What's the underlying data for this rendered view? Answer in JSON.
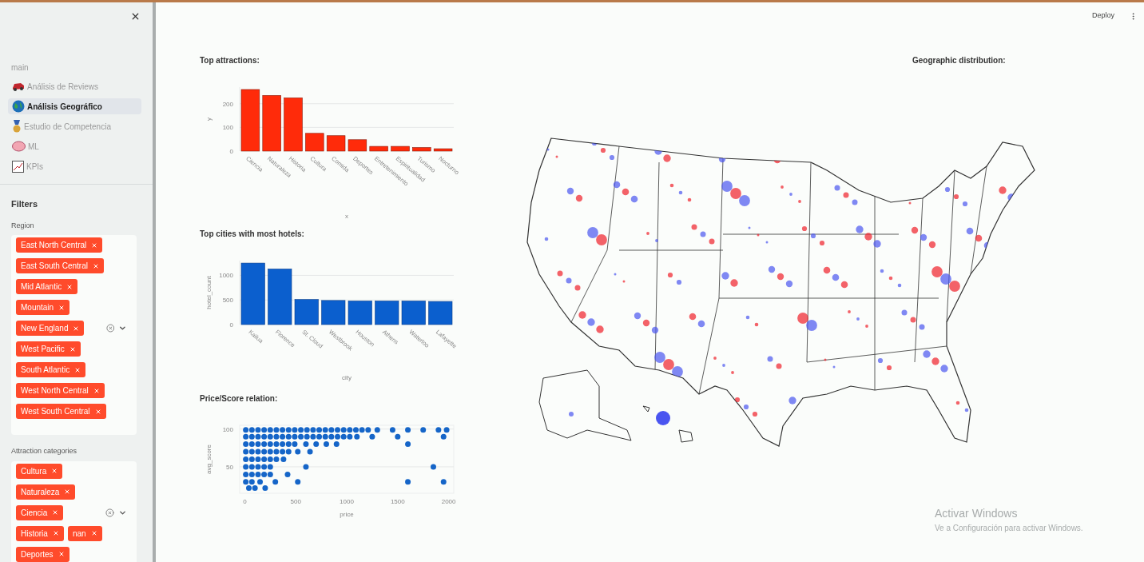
{
  "header": {
    "deploy": "Deploy"
  },
  "sidebar": {
    "section": "main",
    "nav_items": [
      {
        "label": "Análisis de Reviews",
        "selected": false,
        "kind": "car"
      },
      {
        "label": "Análisis Geográfico",
        "selected": true,
        "kind": "globe"
      },
      {
        "label": "Estudio de Competencia",
        "selected": false,
        "kind": "medal"
      },
      {
        "label": "ML",
        "selected": false,
        "kind": "brain"
      },
      {
        "label": "KPIs",
        "selected": false,
        "kind": "chart"
      }
    ],
    "filters": {
      "title": "Filters",
      "groups": [
        {
          "label": "Region",
          "rows": [
            [
              "East North Central"
            ],
            [
              "East South Central"
            ],
            [
              "Mid Atlantic"
            ],
            [
              "Mountain"
            ],
            [
              "New England"
            ],
            [
              "West Pacific"
            ],
            [
              "South Atlantic"
            ],
            [
              "West North Central"
            ],
            [
              "West South Central"
            ]
          ]
        },
        {
          "label": "Attraction categories",
          "rows": [
            [
              "Cultura"
            ],
            [
              "Naturaleza"
            ],
            [
              "Ciencia"
            ],
            [
              "Historia",
              "nan"
            ],
            [
              "Deportes"
            ]
          ]
        }
      ]
    }
  },
  "charts": [
    {
      "title": "Top attractions:",
      "chart_data": {
        "type": "bar",
        "xlabel": "x",
        "ylabel": "y",
        "categories": [
          "Ciencia",
          "Naturaleza",
          "Historia",
          "Cultura",
          "Comida",
          "Deportes",
          "Entretenimiento",
          "Espiritualidad",
          "Turismo",
          "Nocturno"
        ],
        "series": [
          {
            "color": "#ff2b0a",
            "values": [
              260,
              235,
              225,
              75,
              65,
              48,
              20,
              20,
              15,
              10
            ]
          }
        ],
        "ylim": [
          0,
          270
        ],
        "yticks": [
          0,
          100,
          200
        ]
      }
    },
    {
      "title": "Top cities with most hotels:",
      "chart_data": {
        "type": "bar",
        "xlabel": "city",
        "ylabel": "hotel_count",
        "categories": [
          "Kailua",
          "Florence",
          "St. Cloud",
          "Westbrook",
          "Houston",
          "Athens",
          "Waterloo",
          "Lafayette"
        ],
        "series": [
          {
            "color": "#0b5fce",
            "values": [
              1250,
              1130,
              510,
              490,
              480,
              480,
              480,
              470
            ]
          }
        ],
        "ylim": [
          0,
          1300
        ],
        "yticks": [
          0,
          500,
          1000
        ]
      }
    },
    {
      "title": "Price/Score relation:",
      "chart_data": {
        "type": "scatter",
        "xlabel": "price",
        "ylabel": "avg_score",
        "x": [
          10,
          70,
          130,
          190,
          250,
          310,
          370,
          430,
          490,
          550,
          610,
          670,
          730,
          790,
          850,
          910,
          970,
          1030,
          1090,
          1150,
          1210,
          1300,
          1450,
          1600,
          1750,
          1900,
          1980,
          10,
          70,
          130,
          190,
          250,
          310,
          370,
          430,
          490,
          550,
          610,
          670,
          730,
          790,
          850,
          910,
          970,
          1030,
          1100,
          1250,
          1500,
          1950,
          10,
          70,
          130,
          190,
          250,
          310,
          370,
          430,
          490,
          600,
          700,
          800,
          900,
          1600,
          10,
          70,
          130,
          190,
          250,
          310,
          370,
          430,
          520,
          640,
          10,
          70,
          130,
          190,
          250,
          310,
          380,
          10,
          70,
          130,
          190,
          250,
          600,
          1850,
          10,
          70,
          130,
          190,
          250,
          420,
          10,
          70,
          150,
          300,
          520,
          1600,
          1950,
          40,
          100,
          200
        ],
        "series": [
          {
            "color": "#1565c8",
            "values": [
              99,
              99,
              99,
              99,
              99,
              99,
              99,
              99,
              99,
              99,
              99,
              99,
              99,
              99,
              99,
              99,
              99,
              99,
              99,
              99,
              99,
              99,
              99,
              99,
              99,
              99,
              99,
              90,
              90,
              90,
              90,
              90,
              90,
              90,
              90,
              90,
              90,
              90,
              90,
              90,
              90,
              90,
              90,
              90,
              90,
              90,
              90,
              90,
              90,
              80,
              80,
              80,
              80,
              80,
              80,
              80,
              80,
              80,
              80,
              80,
              80,
              80,
              80,
              70,
              70,
              70,
              70,
              70,
              70,
              70,
              70,
              70,
              70,
              60,
              60,
              60,
              60,
              60,
              60,
              60,
              50,
              50,
              50,
              50,
              50,
              50,
              50,
              40,
              40,
              40,
              40,
              40,
              40,
              30,
              30,
              30,
              30,
              30,
              30,
              30,
              22,
              22,
              22
            ]
          }
        ],
        "xlim": [
          -50,
          2050
        ],
        "ylim": [
          15,
          105
        ],
        "xticks": [
          0,
          500,
          1000,
          1500,
          2000
        ],
        "yticks": [
          50,
          100
        ]
      }
    }
  ],
  "map": {
    "title": "Geographic distribution:"
  },
  "activation": {
    "title": "Activar Windows",
    "subtitle": "Ve a Configuración para activar Windows."
  }
}
